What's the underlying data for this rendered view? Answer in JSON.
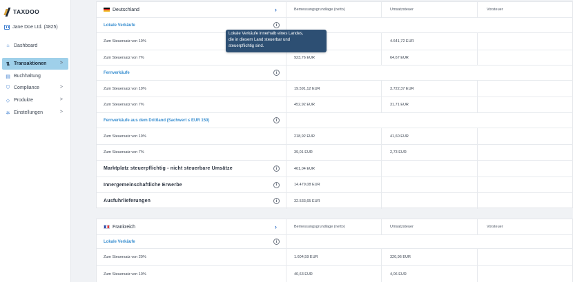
{
  "app": {
    "logo_text": "TAXDOO"
  },
  "sidebar": {
    "company": "Jane Doe Ltd. (#825)",
    "items": [
      {
        "label": "Dashboard",
        "icon": "home-icon",
        "glyph": "⌂"
      },
      {
        "label": "Transaktionen",
        "icon": "transfer-icon",
        "glyph": "⇅",
        "active": true,
        "chevron": true
      },
      {
        "label": "Buchhaltung",
        "icon": "ledger-icon",
        "glyph": "▤"
      },
      {
        "label": "Compliance",
        "icon": "shield-icon",
        "glyph": "⛉",
        "chevron": true
      },
      {
        "label": "Produkte",
        "icon": "tag-icon",
        "glyph": "◇",
        "chevron": true
      },
      {
        "label": "Einstellungen",
        "icon": "gear-icon",
        "glyph": "✲",
        "chevron": true
      }
    ]
  },
  "columns": {
    "base": "Bemessungsgrundlage (netto)",
    "vat": "Umsatzsteuer",
    "input_tax": "Vorsteuer"
  },
  "tooltip": {
    "lines": [
      "Lokale Verkäufe innerhalb eines Landes,",
      "die in diesem Land steuerbar und",
      "steuerpflichtig sind."
    ]
  },
  "germany": {
    "country": "Deutschland",
    "local_sales": {
      "label": "Lokale Verkäufe",
      "rows": [
        {
          "label": "Zum Steuersatz von 19%",
          "base": "",
          "vat": "4.641,72 EUR"
        },
        {
          "label": "Zum Steuersatz von 7%",
          "base": "923,76 EUR",
          "vat": "64,67 EUR"
        }
      ]
    },
    "distance_sales": {
      "label": "Fernverkäufe",
      "rows": [
        {
          "label": "Zum Steuersatz von 19%",
          "base": "19.591,12 EUR",
          "vat": "3.722,37 EUR"
        },
        {
          "label": "Zum Steuersatz von 7%",
          "base": "452,92 EUR",
          "vat": "31,71 EUR"
        }
      ]
    },
    "third_country": {
      "label": "Fernverkäufe aus dem Drittland (Sachwert ≤ EUR 150)",
      "rows": [
        {
          "label": "Zum Steuersatz von 19%",
          "base": "218,92 EUR",
          "vat": "41,60 EUR"
        },
        {
          "label": "Zum Steuersatz von 7%",
          "base": "39,01 EUR",
          "vat": "2,73 EUR"
        }
      ]
    },
    "marketplace": {
      "label": "Marktplatz steuerpflichtig - nicht steuerbare Umsätze",
      "base": "461,04 EUR"
    },
    "intra_community": {
      "label": "Innergemeinschaftliche Erwerbe",
      "base": "14.479,08 EUR"
    },
    "exports": {
      "label": "Ausfuhrlieferungen",
      "base": "32.533,65 EUR"
    }
  },
  "france": {
    "country": "Frankreich",
    "local_sales": {
      "label": "Lokale Verkäufe",
      "rows": [
        {
          "label": "Zum Steuersatz von 20%",
          "base": "1.604,59 EUR",
          "vat": "320,96 EUR"
        },
        {
          "label": "Zum Steuersatz von 10%",
          "base": "40,63 EUR",
          "vat": "4,06 EUR"
        }
      ]
    }
  }
}
